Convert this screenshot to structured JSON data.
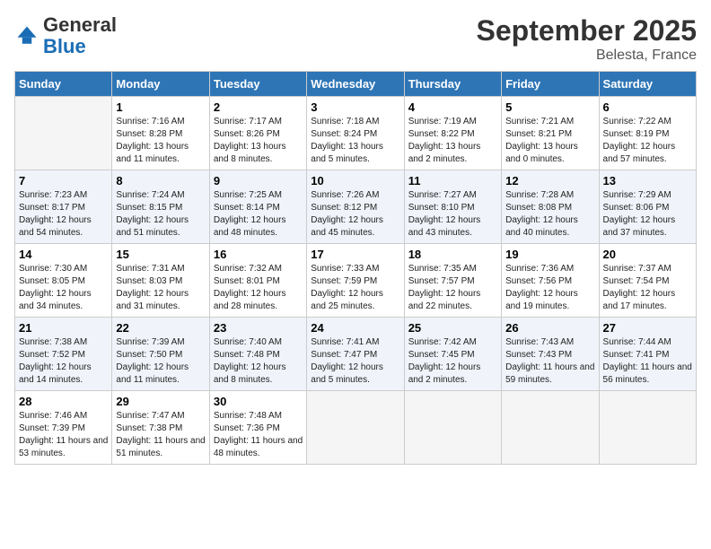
{
  "header": {
    "logo_general": "General",
    "logo_blue": "Blue",
    "month": "September 2025",
    "location": "Belesta, France"
  },
  "weekdays": [
    "Sunday",
    "Monday",
    "Tuesday",
    "Wednesday",
    "Thursday",
    "Friday",
    "Saturday"
  ],
  "weeks": [
    [
      {
        "day": "",
        "sunrise": "",
        "sunset": "",
        "daylight": "",
        "empty": true
      },
      {
        "day": "1",
        "sunrise": "Sunrise: 7:16 AM",
        "sunset": "Sunset: 8:28 PM",
        "daylight": "Daylight: 13 hours and 11 minutes."
      },
      {
        "day": "2",
        "sunrise": "Sunrise: 7:17 AM",
        "sunset": "Sunset: 8:26 PM",
        "daylight": "Daylight: 13 hours and 8 minutes."
      },
      {
        "day": "3",
        "sunrise": "Sunrise: 7:18 AM",
        "sunset": "Sunset: 8:24 PM",
        "daylight": "Daylight: 13 hours and 5 minutes."
      },
      {
        "day": "4",
        "sunrise": "Sunrise: 7:19 AM",
        "sunset": "Sunset: 8:22 PM",
        "daylight": "Daylight: 13 hours and 2 minutes."
      },
      {
        "day": "5",
        "sunrise": "Sunrise: 7:21 AM",
        "sunset": "Sunset: 8:21 PM",
        "daylight": "Daylight: 13 hours and 0 minutes."
      },
      {
        "day": "6",
        "sunrise": "Sunrise: 7:22 AM",
        "sunset": "Sunset: 8:19 PM",
        "daylight": "Daylight: 12 hours and 57 minutes."
      }
    ],
    [
      {
        "day": "7",
        "sunrise": "Sunrise: 7:23 AM",
        "sunset": "Sunset: 8:17 PM",
        "daylight": "Daylight: 12 hours and 54 minutes."
      },
      {
        "day": "8",
        "sunrise": "Sunrise: 7:24 AM",
        "sunset": "Sunset: 8:15 PM",
        "daylight": "Daylight: 12 hours and 51 minutes."
      },
      {
        "day": "9",
        "sunrise": "Sunrise: 7:25 AM",
        "sunset": "Sunset: 8:14 PM",
        "daylight": "Daylight: 12 hours and 48 minutes."
      },
      {
        "day": "10",
        "sunrise": "Sunrise: 7:26 AM",
        "sunset": "Sunset: 8:12 PM",
        "daylight": "Daylight: 12 hours and 45 minutes."
      },
      {
        "day": "11",
        "sunrise": "Sunrise: 7:27 AM",
        "sunset": "Sunset: 8:10 PM",
        "daylight": "Daylight: 12 hours and 43 minutes."
      },
      {
        "day": "12",
        "sunrise": "Sunrise: 7:28 AM",
        "sunset": "Sunset: 8:08 PM",
        "daylight": "Daylight: 12 hours and 40 minutes."
      },
      {
        "day": "13",
        "sunrise": "Sunrise: 7:29 AM",
        "sunset": "Sunset: 8:06 PM",
        "daylight": "Daylight: 12 hours and 37 minutes."
      }
    ],
    [
      {
        "day": "14",
        "sunrise": "Sunrise: 7:30 AM",
        "sunset": "Sunset: 8:05 PM",
        "daylight": "Daylight: 12 hours and 34 minutes."
      },
      {
        "day": "15",
        "sunrise": "Sunrise: 7:31 AM",
        "sunset": "Sunset: 8:03 PM",
        "daylight": "Daylight: 12 hours and 31 minutes."
      },
      {
        "day": "16",
        "sunrise": "Sunrise: 7:32 AM",
        "sunset": "Sunset: 8:01 PM",
        "daylight": "Daylight: 12 hours and 28 minutes."
      },
      {
        "day": "17",
        "sunrise": "Sunrise: 7:33 AM",
        "sunset": "Sunset: 7:59 PM",
        "daylight": "Daylight: 12 hours and 25 minutes."
      },
      {
        "day": "18",
        "sunrise": "Sunrise: 7:35 AM",
        "sunset": "Sunset: 7:57 PM",
        "daylight": "Daylight: 12 hours and 22 minutes."
      },
      {
        "day": "19",
        "sunrise": "Sunrise: 7:36 AM",
        "sunset": "Sunset: 7:56 PM",
        "daylight": "Daylight: 12 hours and 19 minutes."
      },
      {
        "day": "20",
        "sunrise": "Sunrise: 7:37 AM",
        "sunset": "Sunset: 7:54 PM",
        "daylight": "Daylight: 12 hours and 17 minutes."
      }
    ],
    [
      {
        "day": "21",
        "sunrise": "Sunrise: 7:38 AM",
        "sunset": "Sunset: 7:52 PM",
        "daylight": "Daylight: 12 hours and 14 minutes."
      },
      {
        "day": "22",
        "sunrise": "Sunrise: 7:39 AM",
        "sunset": "Sunset: 7:50 PM",
        "daylight": "Daylight: 12 hours and 11 minutes."
      },
      {
        "day": "23",
        "sunrise": "Sunrise: 7:40 AM",
        "sunset": "Sunset: 7:48 PM",
        "daylight": "Daylight: 12 hours and 8 minutes."
      },
      {
        "day": "24",
        "sunrise": "Sunrise: 7:41 AM",
        "sunset": "Sunset: 7:47 PM",
        "daylight": "Daylight: 12 hours and 5 minutes."
      },
      {
        "day": "25",
        "sunrise": "Sunrise: 7:42 AM",
        "sunset": "Sunset: 7:45 PM",
        "daylight": "Daylight: 12 hours and 2 minutes."
      },
      {
        "day": "26",
        "sunrise": "Sunrise: 7:43 AM",
        "sunset": "Sunset: 7:43 PM",
        "daylight": "Daylight: 11 hours and 59 minutes."
      },
      {
        "day": "27",
        "sunrise": "Sunrise: 7:44 AM",
        "sunset": "Sunset: 7:41 PM",
        "daylight": "Daylight: 11 hours and 56 minutes."
      }
    ],
    [
      {
        "day": "28",
        "sunrise": "Sunrise: 7:46 AM",
        "sunset": "Sunset: 7:39 PM",
        "daylight": "Daylight: 11 hours and 53 minutes."
      },
      {
        "day": "29",
        "sunrise": "Sunrise: 7:47 AM",
        "sunset": "Sunset: 7:38 PM",
        "daylight": "Daylight: 11 hours and 51 minutes."
      },
      {
        "day": "30",
        "sunrise": "Sunrise: 7:48 AM",
        "sunset": "Sunset: 7:36 PM",
        "daylight": "Daylight: 11 hours and 48 minutes."
      },
      {
        "day": "",
        "sunrise": "",
        "sunset": "",
        "daylight": "",
        "empty": true
      },
      {
        "day": "",
        "sunrise": "",
        "sunset": "",
        "daylight": "",
        "empty": true
      },
      {
        "day": "",
        "sunrise": "",
        "sunset": "",
        "daylight": "",
        "empty": true
      },
      {
        "day": "",
        "sunrise": "",
        "sunset": "",
        "daylight": "",
        "empty": true
      }
    ]
  ]
}
